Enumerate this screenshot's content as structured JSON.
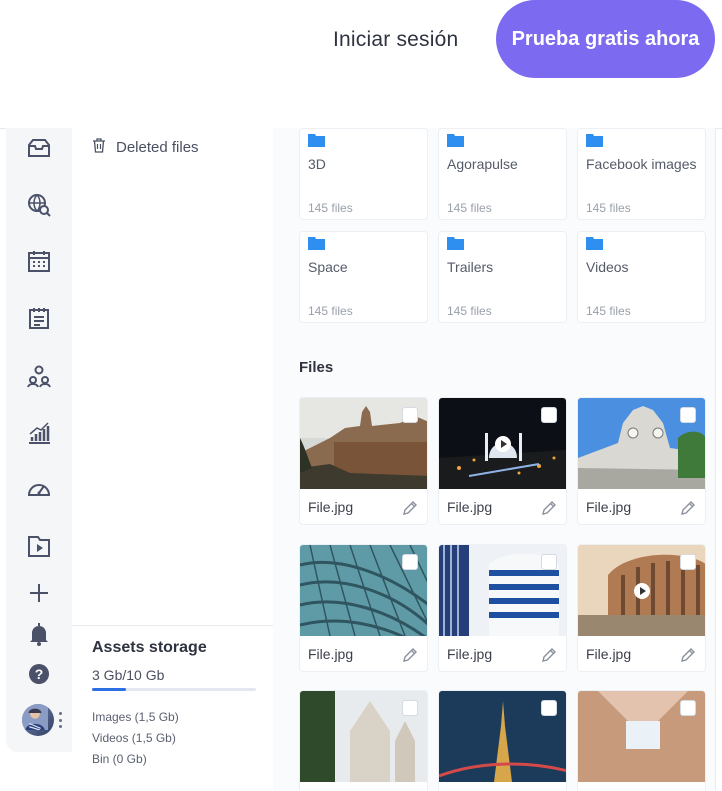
{
  "header": {
    "login_label": "Iniciar sesión",
    "trial_label": "Prueba gratis ahora",
    "accent": "#7c6bf0"
  },
  "rail": {
    "icons": [
      "inbox-icon",
      "globe-search-icon",
      "calendar-icon",
      "notepad-icon",
      "team-icon",
      "analytics-icon",
      "gauge-icon",
      "media-library-icon",
      "plus-icon",
      "bell-icon",
      "help-icon"
    ]
  },
  "panel": {
    "deleted_label": "Deleted files",
    "storage_title": "Assets storage",
    "storage_used": "3 Gb/10 Gb",
    "storage_fraction": 0.21,
    "breakdown": [
      "Images (1,5 Gb)",
      "Videos (1,5 Gb)",
      "Bin (0 Gb)"
    ]
  },
  "folders": [
    {
      "name": "3D",
      "count": "145 files"
    },
    {
      "name": "Agorapulse",
      "count": "145 files"
    },
    {
      "name": "Facebook images",
      "count": "145 files"
    },
    {
      "name": "Space",
      "count": "145 files"
    },
    {
      "name": "Trailers",
      "count": "145 files"
    },
    {
      "name": "Videos",
      "count": "145 files"
    }
  ],
  "files_heading": "Files",
  "files": [
    {
      "name": "File.jpg",
      "thumb": "castle-photo",
      "video": false
    },
    {
      "name": "File.jpg",
      "thumb": "mosque-night-photo",
      "video": true
    },
    {
      "name": "File.jpg",
      "thumb": "clock-tower-photo",
      "video": false
    },
    {
      "name": "File.jpg",
      "thumb": "glass-roof-photo",
      "video": false
    },
    {
      "name": "File.jpg",
      "thumb": "building-stripes-photo",
      "video": false
    },
    {
      "name": "File.jpg",
      "thumb": "colosseum-photo",
      "video": true
    },
    {
      "name": "",
      "thumb": "church-photo",
      "video": false
    },
    {
      "name": "",
      "thumb": "eiffel-night-photo",
      "video": false
    },
    {
      "name": "",
      "thumb": "skylight-photo",
      "video": false
    }
  ],
  "colors": {
    "folder": "#2f8ff0",
    "progress": "#2f6fe6"
  }
}
